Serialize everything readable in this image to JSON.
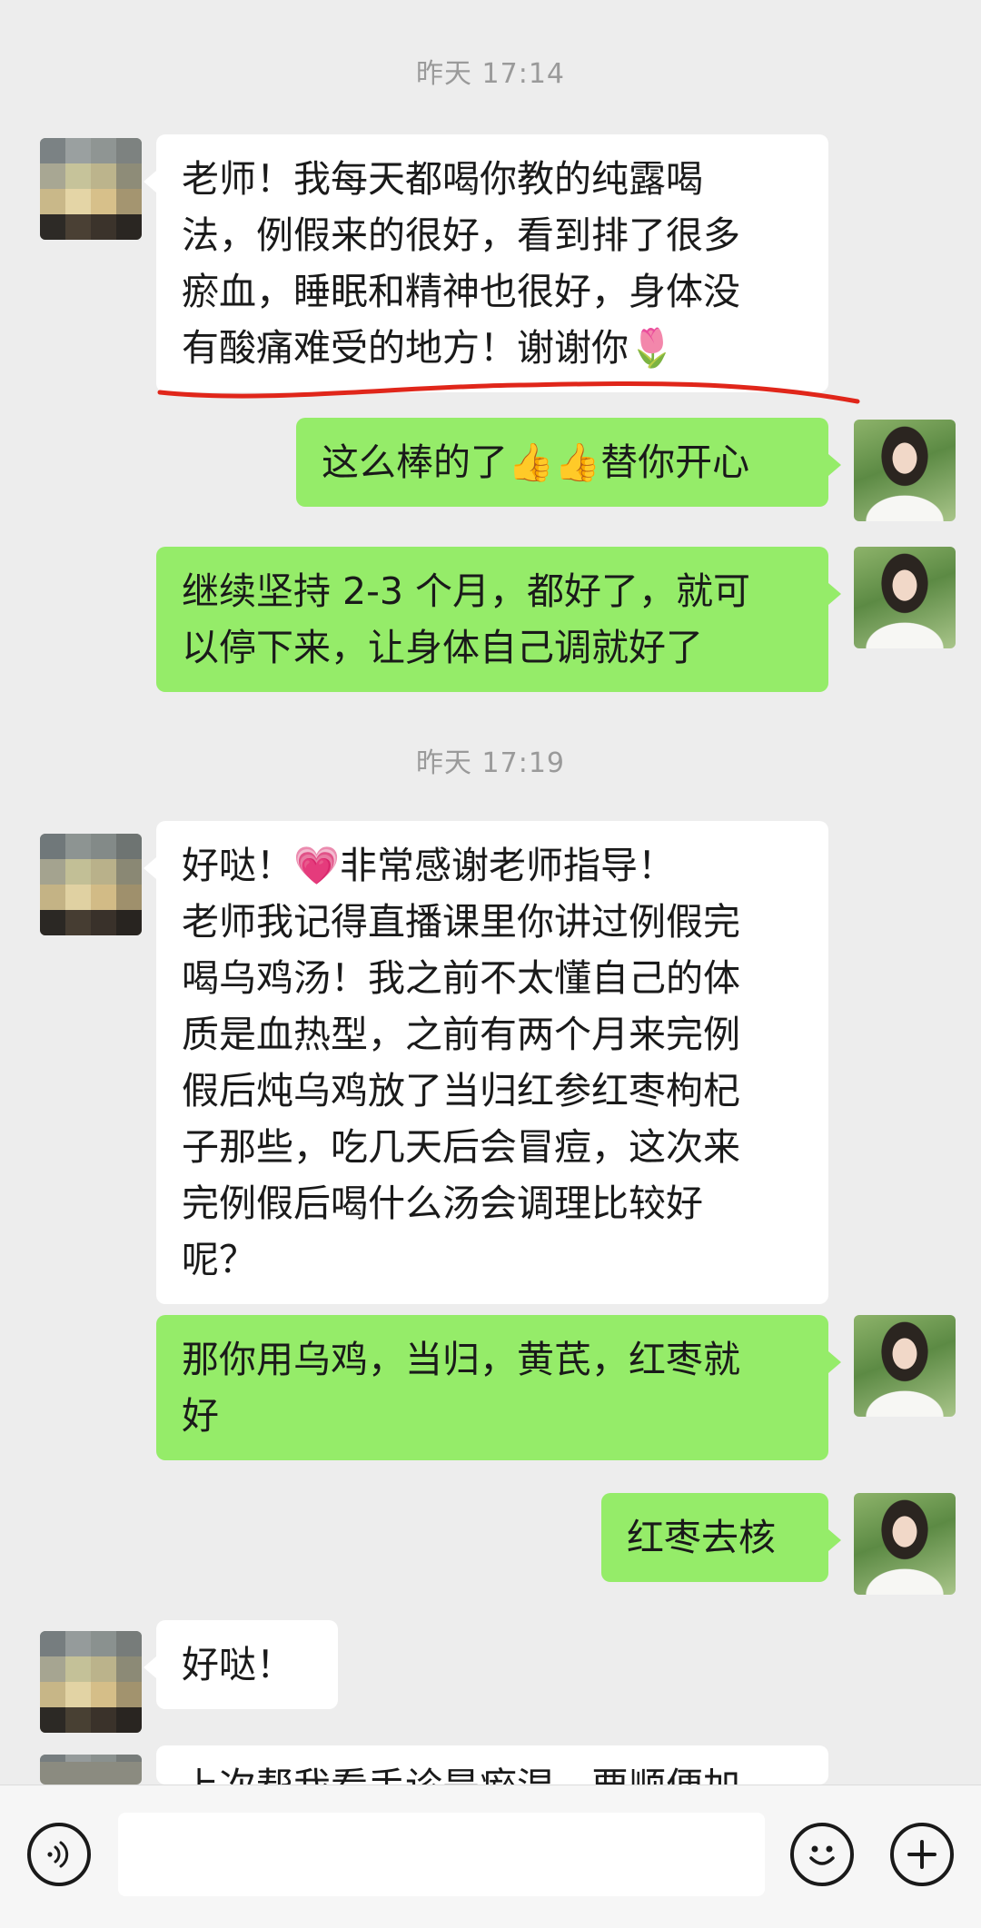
{
  "chat": {
    "timestamps": [
      "昨天 17:14",
      "昨天 17:19"
    ],
    "messages": [
      {
        "from": "user",
        "lines": [
          "老师！我每天都喝你教的纯露喝",
          "法，例假来的很好，看到排了很多",
          "瘀血，睡眠和精神也很好，身体没",
          "有酸痛难受的地方！谢谢你🌷"
        ]
      },
      {
        "from": "teacher",
        "lines": [
          "这么棒的了👍👍替你开心"
        ]
      },
      {
        "from": "teacher",
        "lines": [
          "继续坚持 2-3 个月，都好了，就可",
          "以停下来，让身体自己调就好了"
        ]
      },
      {
        "from": "user",
        "lines": [
          "好哒！💗非常感谢老师指导！",
          "老师我记得直播课里你讲过例假完",
          "喝乌鸡汤！我之前不太懂自己的体",
          "质是血热型，之前有两个月来完例",
          "假后炖乌鸡放了当归红参红枣枸杞",
          "子那些，吃几天后会冒痘，这次来",
          "完例假后喝什么汤会调理比较好",
          "呢？"
        ]
      },
      {
        "from": "teacher",
        "lines": [
          "那你用乌鸡，当归，黄芪，红枣就",
          "好"
        ]
      },
      {
        "from": "teacher",
        "lines": [
          "红枣去核"
        ]
      },
      {
        "from": "user",
        "lines": [
          "好哒！"
        ]
      },
      {
        "from": "user",
        "lines": [
          "上次帮我看手诊是瘀湿，要顺便加"
        ]
      }
    ]
  },
  "colors": {
    "background": "#ededed",
    "outgoing_bubble": "#95ec69",
    "incoming_bubble": "#ffffff",
    "annotation_line": "#e0261a"
  },
  "input_bar": {
    "voice_icon": "voice-icon",
    "emoji_icon": "emoji-icon",
    "plus_icon": "plus-icon"
  }
}
